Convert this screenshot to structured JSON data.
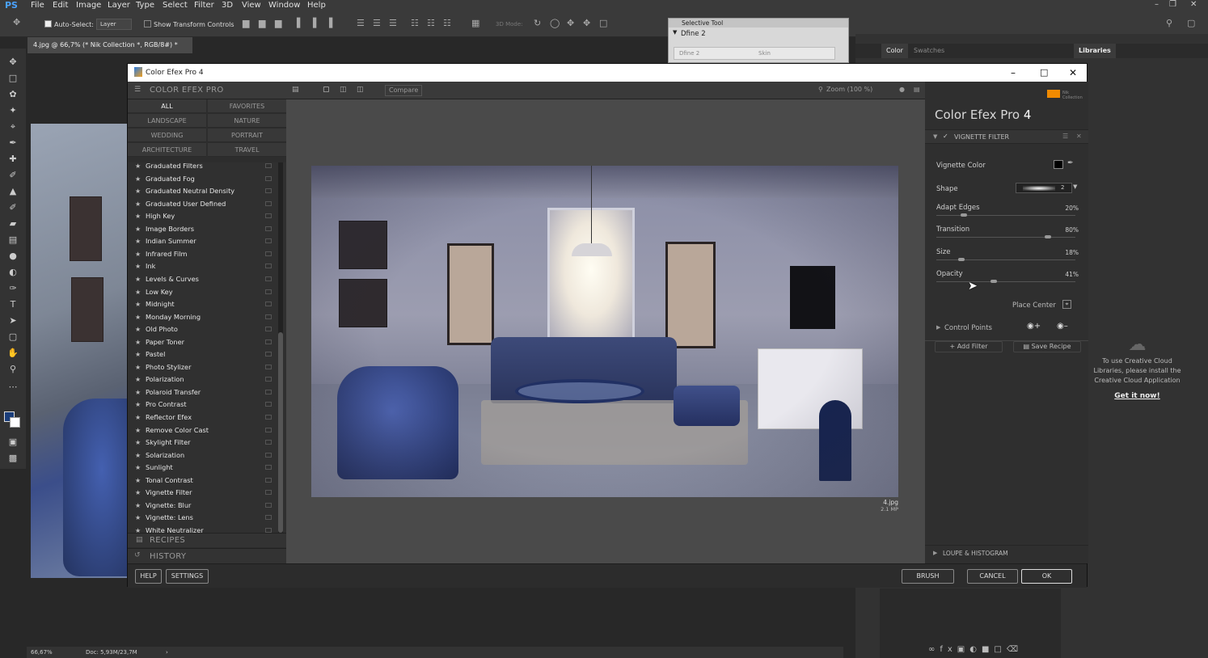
{
  "photoshop": {
    "logo": "PS",
    "menu": [
      "File",
      "Edit",
      "Image",
      "Layer",
      "Type",
      "Select",
      "Filter",
      "3D",
      "View",
      "Window",
      "Help"
    ],
    "options": {
      "auto_select_label": "Auto-Select:",
      "layer_dropdown": "Layer",
      "show_transform_label": "Show Transform Controls",
      "mode_3d": "3D Mode:"
    },
    "document_tab": "4.jpg @ 66,7% (* Nik Collection *, RGB/8#) *",
    "status": {
      "zoom": "66,67%",
      "doc": "Doc: 5,93M/23,7M"
    },
    "right_panel": {
      "tabs": [
        "Color",
        "Swatches",
        "Libraries"
      ]
    },
    "libraries_message": "To use Creative Cloud Libraries, please install the Creative Cloud Application",
    "libraries_link": "Get it now!"
  },
  "selective_tool": {
    "title": "Selective Tool",
    "item": "Dfine 2",
    "faded_items": [
      "Dfine 2",
      "Skin"
    ]
  },
  "nik": {
    "window_title": "Color Efex Pro 4",
    "left_header": "COLOR EFEX PRO",
    "categories": [
      "ALL",
      "FAVORITES",
      "LANDSCAPE",
      "NATURE",
      "WEDDING",
      "PORTRAIT",
      "ARCHITECTURE",
      "TRAVEL"
    ],
    "filters": [
      "Graduated Filters",
      "Graduated Fog",
      "Graduated Neutral Density",
      "Graduated User Defined",
      "High Key",
      "Image Borders",
      "Indian Summer",
      "Infrared Film",
      "Ink",
      "Levels & Curves",
      "Low Key",
      "Midnight",
      "Monday Morning",
      "Old Photo",
      "Paper Toner",
      "Pastel",
      "Photo Stylizer",
      "Polarization",
      "Polaroid Transfer",
      "Pro Contrast",
      "Reflector Efex",
      "Remove Color Cast",
      "Skylight Filter",
      "Solarization",
      "Sunlight",
      "Tonal Contrast",
      "Vignette Filter",
      "Vignette: Blur",
      "Vignette: Lens",
      "White Neutralizer"
    ],
    "recipes_label": "RECIPES",
    "history_label": "HISTORY",
    "toolbar": {
      "compare": "Compare",
      "zoom": "Zoom (100 %)"
    },
    "image_info": {
      "name": "4.jpg",
      "size": "2.1 MP"
    },
    "right": {
      "brand_small": "Nik Collection",
      "title_main": "Color Efex Pro",
      "title_num": "4",
      "filter_name": "VIGNETTE FILTER",
      "vignette_color_label": "Vignette Color",
      "shape_label": "Shape",
      "shape_value": "2",
      "sliders": [
        {
          "label": "Adapt Edges",
          "value": "20%",
          "fraction": 0.2
        },
        {
          "label": "Transition",
          "value": "80%",
          "fraction": 0.8
        },
        {
          "label": "Size",
          "value": "18%",
          "fraction": 0.18
        },
        {
          "label": "Opacity",
          "value": "41%",
          "fraction": 0.41
        }
      ],
      "place_center": "Place Center",
      "control_points": "Control Points",
      "add_filter": "Add Filter",
      "save_recipe": "Save Recipe",
      "loupe": "LOUPE & HISTOGRAM"
    },
    "bottom": {
      "help": "HELP",
      "settings": "SETTINGS",
      "brush": "BRUSH",
      "cancel": "CANCEL",
      "ok": "OK"
    }
  },
  "colors": {
    "accent": "#f08a00",
    "window_bg": "#333333"
  }
}
